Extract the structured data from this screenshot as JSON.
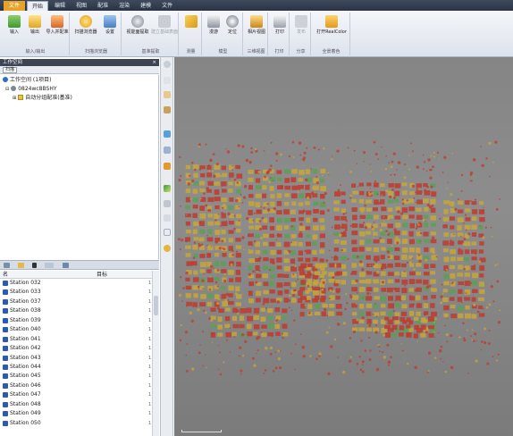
{
  "tabs": [
    "文件",
    "开始",
    "编辑",
    "视图",
    "配准",
    "渲染",
    "建模",
    "文件"
  ],
  "ribbon": {
    "groups": [
      {
        "caption": "输入/输出",
        "buttons": [
          {
            "label": "输入"
          },
          {
            "label": "输出"
          },
          {
            "label": "导入并配准"
          }
        ]
      },
      {
        "caption": "扫描浏览器",
        "buttons": [
          {
            "label": "扫描浏览器"
          },
          {
            "label": "设置"
          }
        ]
      },
      {
        "caption": "基准提取",
        "buttons": [
          {
            "label": "视能面提取"
          },
          {
            "label": "建立基础表面"
          }
        ]
      },
      {
        "caption": "测量",
        "buttons": [
          {
            "label": ""
          }
        ]
      },
      {
        "caption": "模型",
        "buttons": [
          {
            "label": "漫游"
          },
          {
            "label": "定位"
          }
        ]
      },
      {
        "caption": "三维视图",
        "buttons": [
          {
            "label": "相片视图"
          }
        ]
      },
      {
        "caption": "打印",
        "buttons": [
          {
            "label": "打印"
          }
        ]
      },
      {
        "caption": "分享",
        "buttons": [
          {
            "label": "发布"
          }
        ]
      },
      {
        "caption": "全景着色",
        "buttons": [
          {
            "label": "打开RealColor"
          }
        ]
      }
    ]
  },
  "workspace": {
    "title": "工作空间",
    "close": "×",
    "toolbar_button": "扫描",
    "tree": [
      {
        "label": "工作空间  (1项目)"
      },
      {
        "label": "0824wc8BSHY"
      },
      {
        "label": "自动分组配准(基准)"
      }
    ]
  },
  "list": {
    "columns": [
      "名",
      "目标"
    ],
    "rows": [
      {
        "name": "Station 032",
        "val": "1"
      },
      {
        "name": "Station 033",
        "val": "1"
      },
      {
        "name": "Station 037",
        "val": "1"
      },
      {
        "name": "Station 038",
        "val": "1"
      },
      {
        "name": "Station 039",
        "val": "1"
      },
      {
        "name": "Station 040",
        "val": "1"
      },
      {
        "name": "Station 041",
        "val": "1"
      },
      {
        "name": "Station 042",
        "val": "1"
      },
      {
        "name": "Station 043",
        "val": "1"
      },
      {
        "name": "Station 044",
        "val": "1"
      },
      {
        "name": "Station 045",
        "val": "1"
      },
      {
        "name": "Station 046",
        "val": "1"
      },
      {
        "name": "Station 047",
        "val": "1"
      },
      {
        "name": "Station 048",
        "val": "1"
      },
      {
        "name": "Station 049",
        "val": "1"
      },
      {
        "name": "Station 050",
        "val": "1"
      }
    ]
  },
  "colors": {
    "file_tab": "#e8a228",
    "station_icon": "#2b59b8",
    "viewport_bg": "#858585",
    "cloud_red": "#c0392b",
    "cloud_yellow": "#c8a636",
    "cloud_green": "#5aa052"
  }
}
